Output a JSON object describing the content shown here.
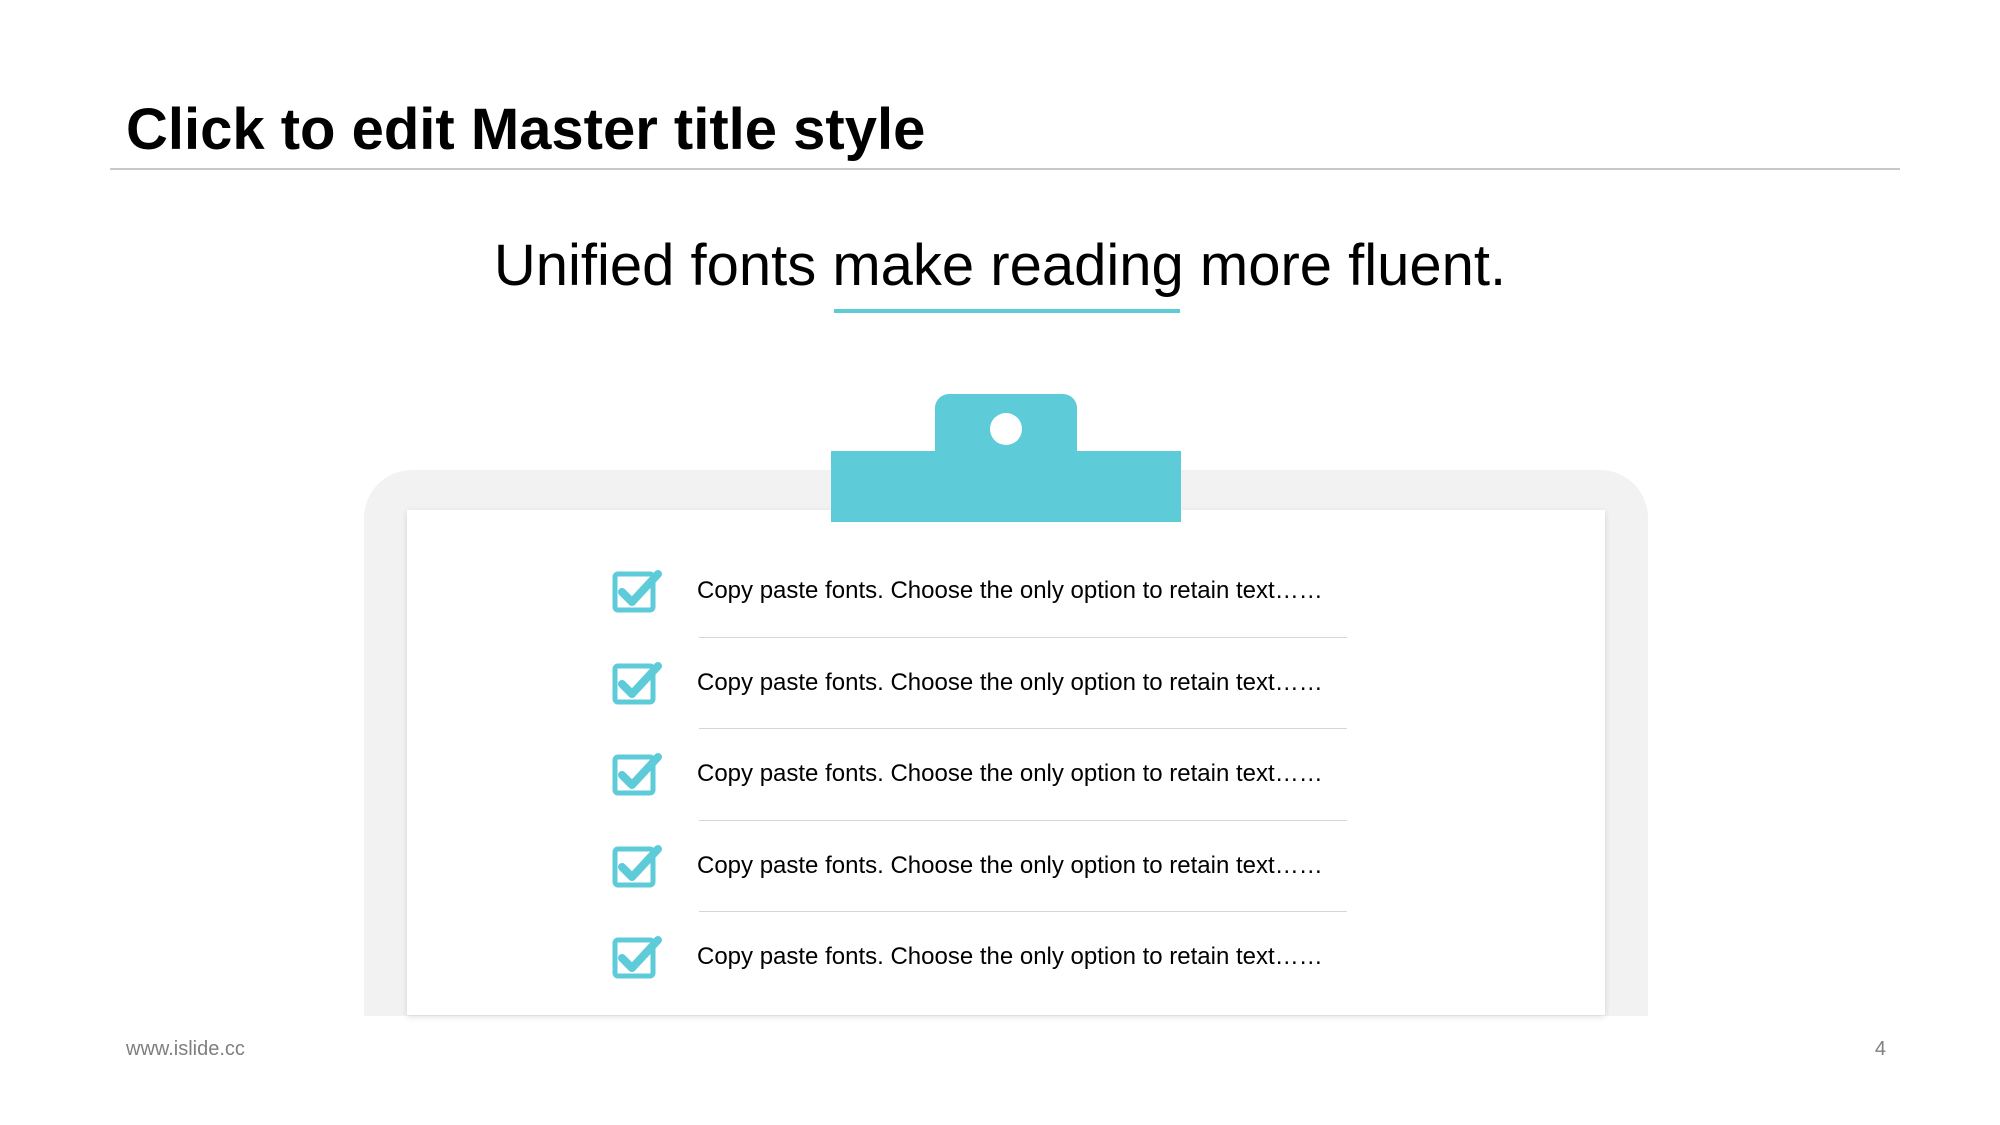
{
  "slide": {
    "title": "Click to edit Master title style",
    "subtitle": "Unified fonts make reading more fluent.",
    "checklist": [
      {
        "text": "Copy paste fonts. Choose the only option to retain text……",
        "icon": "checked-box-icon"
      },
      {
        "text": "Copy paste fonts. Choose the only option to retain text……",
        "icon": "checked-box-icon"
      },
      {
        "text": "Copy paste fonts. Choose the only option to retain text……",
        "icon": "checked-box-icon"
      },
      {
        "text": "Copy paste fonts. Choose the only option to retain text……",
        "icon": "checked-box-icon"
      },
      {
        "text": "Copy paste fonts. Choose the only option to retain text……",
        "icon": "checked-box-icon"
      }
    ]
  },
  "footer": {
    "url": "www.islide.cc",
    "page_number": "4"
  },
  "colors": {
    "accent": "#5ecbd9",
    "frame": "#f2f2f2",
    "divider": "#c8c8c8",
    "footer_text": "#7f7f7f"
  }
}
